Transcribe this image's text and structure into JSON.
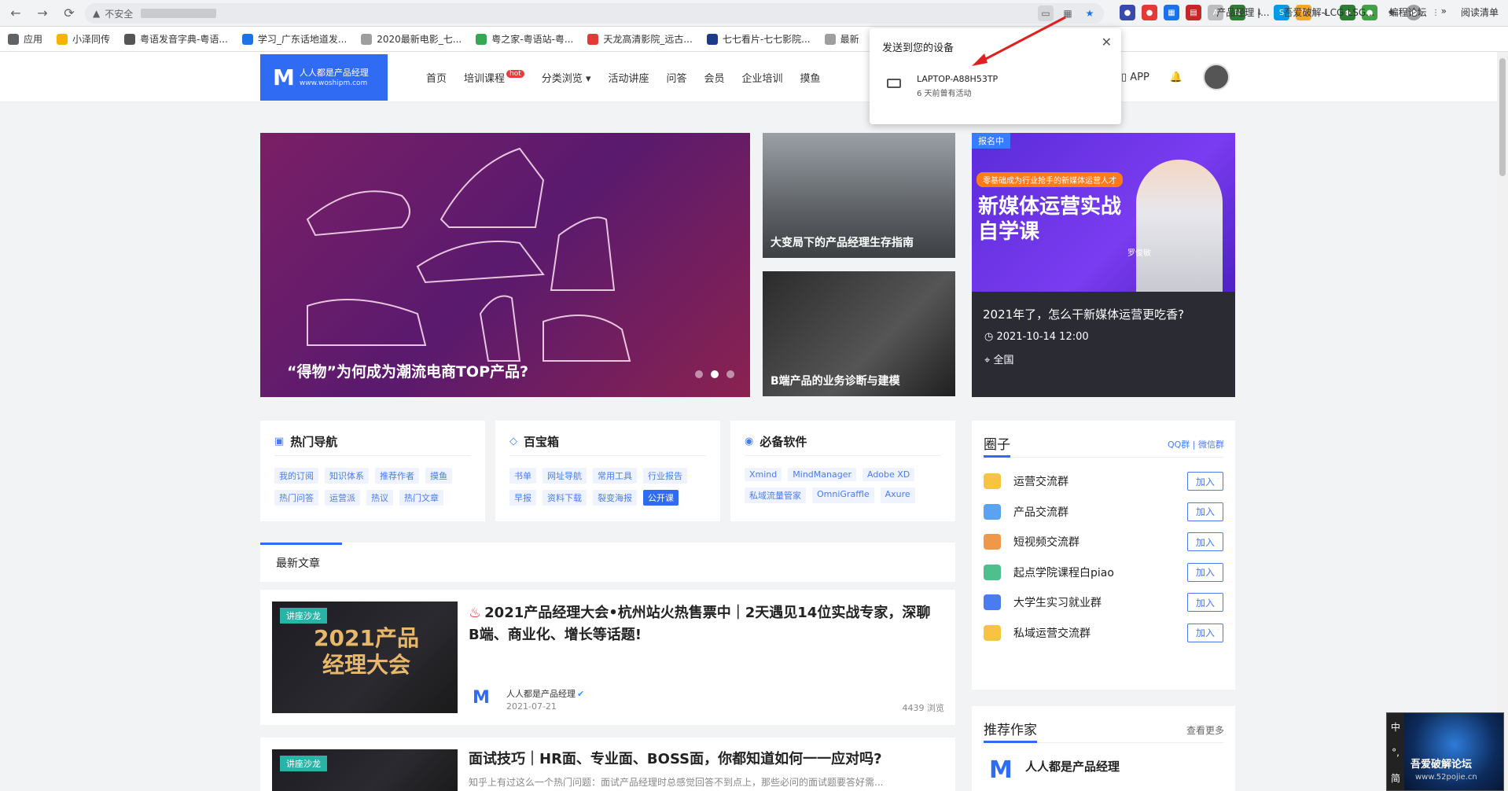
{
  "browser": {
    "insecure_label": "不安全",
    "bookmarks": [
      {
        "label": "应用",
        "color": "#5f6368"
      },
      {
        "label": "小泽同传",
        "color": "#f4b400"
      },
      {
        "label": "粤语发音字典-粤语...",
        "color": "#555555"
      },
      {
        "label": "学习_广东话地道发...",
        "color": "#1a73e8"
      },
      {
        "label": "2020最新电影_七...",
        "color": "#9e9e9e"
      },
      {
        "label": "粤之家-粤语站-粤...",
        "color": "#34a853"
      },
      {
        "label": "天龙高清影院_远古...",
        "color": "#e53935"
      },
      {
        "label": "七七看片-七七影院...",
        "color": "#1e3a8a"
      },
      {
        "label": "最新",
        "color": "#9e9e9e"
      }
    ],
    "bookmarks_right": [
      "产品经理 |...",
      "吾爱破解-LCG-LSG...",
      "编程论坛",
      "»",
      "阅读清单"
    ]
  },
  "popup": {
    "title": "发送到您的设备",
    "device_name": "LAPTOP-A88H53TP",
    "device_sub": "6 天前曾有活动"
  },
  "site": {
    "logo_text": "人人都是产品经理",
    "logo_url": "www.woshipm.com",
    "nav": [
      "首页",
      "培训课程",
      "分类浏览",
      "活动讲座",
      "问答",
      "会员",
      "企业培训",
      "摸鱼"
    ],
    "hot_badge": "hot",
    "app_label": "APP"
  },
  "banner": {
    "main_caption": "“得物”为何成为潮流电商TOP产品?",
    "side_a": "大变局下的产品经理生存指南",
    "side_b": "B端产品的业务诊断与建模"
  },
  "promo": {
    "tag": "报名中",
    "ribbon": "零基础成为行业抢手的新媒体运营人才",
    "headline": "新媒体运营实战自学课",
    "speaker": "罗俊敏",
    "title": "2021年了，怎么干新媒体运营更吃香?",
    "date": "2021-10-14 12:00",
    "location": "全国"
  },
  "hot_nav": {
    "title": "热门导航",
    "tags": [
      "我的订阅",
      "知识体系",
      "推荐作者",
      "摸鱼",
      "热门问答",
      "运营派",
      "热议",
      "热门文章"
    ]
  },
  "toolbox": {
    "title": "百宝箱",
    "tags": [
      "书单",
      "网址导航",
      "常用工具",
      "行业报告",
      "早报",
      "资料下载",
      "裂变海报",
      "公开课"
    ]
  },
  "software": {
    "title": "必备软件",
    "tags": [
      "Xmind",
      "MindManager",
      "Adobe XD",
      "私域流量管家",
      "OmniGraffle",
      "Axure"
    ]
  },
  "latest": {
    "tab": "最新文章",
    "articles": [
      {
        "tag": "讲座沙龙",
        "thumb_text": "2021产品经理大会",
        "title": "2021产品经理大会•杭州站火热售票中｜2天遇见14位实战专家，深聊B端、商业化、增长等话题!",
        "author": "人人都是产品经理",
        "date": "2021-07-21",
        "views": "4439 浏览"
      },
      {
        "tag": "讲座沙龙",
        "title": "面试技巧｜HR面、专业面、BOSS面，你都知道如何一一应对吗?",
        "excerpt": "知乎上有过这么一个热门问题：面试产品经理时总感觉回答不到点上，那些必问的面试题要答好需..."
      }
    ]
  },
  "circle": {
    "title": "圈子",
    "right": "QQ群 | 微信群",
    "join_label": "加入",
    "groups": [
      {
        "name": "运营交流群",
        "color": "#f6c342"
      },
      {
        "name": "产品交流群",
        "color": "#5aa3f0"
      },
      {
        "name": "短视频交流群",
        "color": "#f0984a"
      },
      {
        "name": "起点学院课程白piao",
        "color": "#4fc08d"
      },
      {
        "name": "大学生实习就业群",
        "color": "#4a7cf0"
      },
      {
        "name": "私域运营交流群",
        "color": "#f6c342"
      }
    ]
  },
  "writers": {
    "title": "推荐作家",
    "more": "查看更多",
    "name": "人人都是产品经理"
  },
  "ime": {
    "side": [
      "中",
      "°,",
      "简"
    ],
    "caption": "吾爱破解论坛",
    "url": "www.52pojie.cn"
  }
}
